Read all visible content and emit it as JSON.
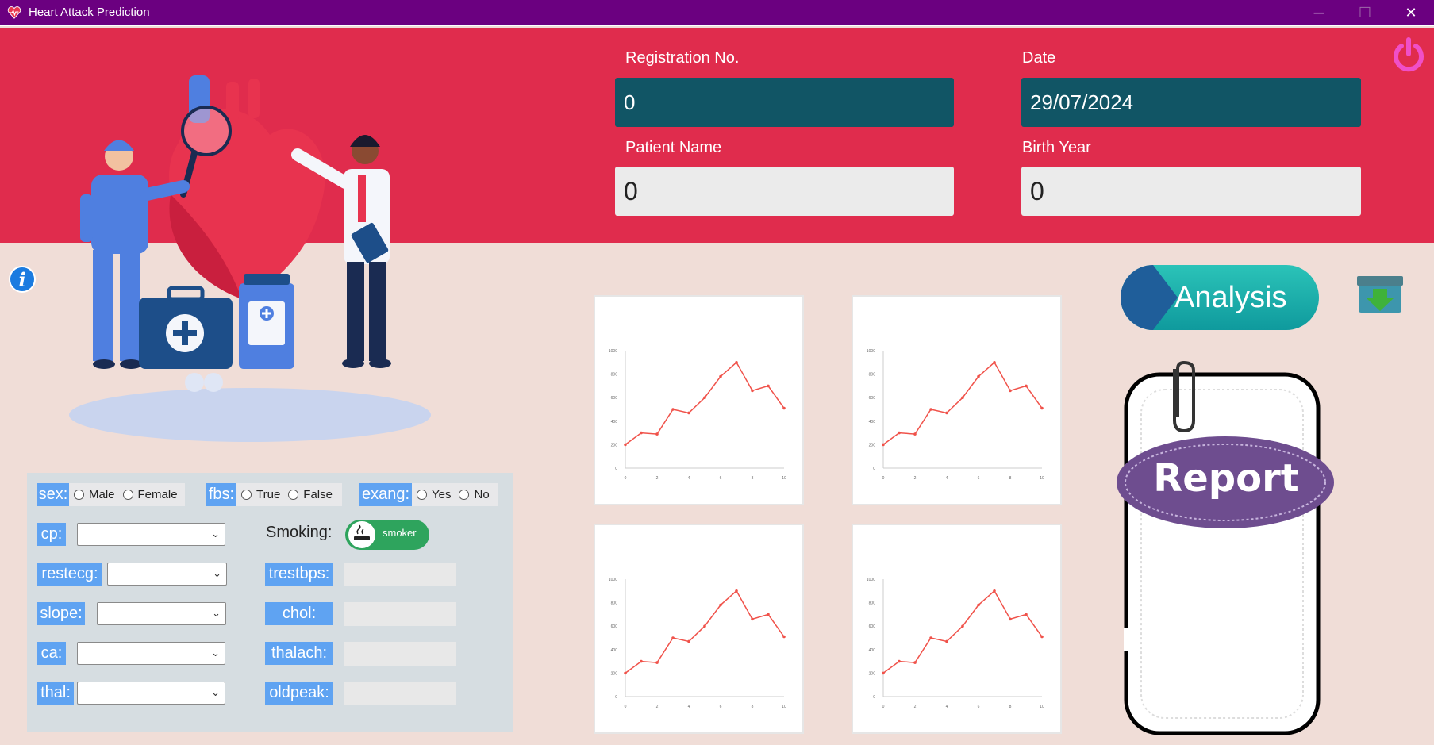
{
  "window": {
    "title": "Heart Attack Prediction",
    "minimize": "─",
    "maximize": "☐",
    "close": "✕"
  },
  "header": {
    "registration_label": "Registration No.",
    "registration_value": "0",
    "date_label": "Date",
    "date_value": "29/07/2024",
    "patient_label": "Patient Name",
    "patient_value": "0",
    "birth_label": "Birth Year",
    "birth_value": "0"
  },
  "form": {
    "sex": {
      "label": "sex:",
      "options": [
        "Male",
        "Female"
      ]
    },
    "fbs": {
      "label": "fbs:",
      "options": [
        "True",
        "False"
      ]
    },
    "exang": {
      "label": "exang:",
      "options": [
        "Yes",
        "No"
      ]
    },
    "cp": {
      "label": "cp:"
    },
    "restecg": {
      "label": "restecg:"
    },
    "slope": {
      "label": "slope:"
    },
    "ca": {
      "label": "ca:"
    },
    "thal": {
      "label": "thal:"
    },
    "smoking": {
      "label": "Smoking:",
      "toggle_text": "smoker"
    },
    "trestbps": {
      "label": "trestbps:"
    },
    "chol": {
      "label": "chol:"
    },
    "thalach": {
      "label": "thalach:"
    },
    "oldpeak": {
      "label": "oldpeak:"
    }
  },
  "buttons": {
    "analysis": "Analysis",
    "report": "Report"
  },
  "chart_data": [
    {
      "type": "line",
      "x": [
        0,
        1,
        2,
        3,
        4,
        5,
        6,
        7,
        8,
        9,
        10
      ],
      "y": [
        200,
        300,
        290,
        500,
        470,
        600,
        780,
        900,
        660,
        700,
        510
      ],
      "xlim": [
        0,
        10
      ],
      "ylim": [
        0,
        1000
      ],
      "xticks": [
        "0",
        "2",
        "4",
        "6",
        "8",
        "10"
      ],
      "yticks": [
        "0",
        "200",
        "400",
        "600",
        "800",
        "1000"
      ]
    },
    {
      "type": "line",
      "x": [
        0,
        1,
        2,
        3,
        4,
        5,
        6,
        7,
        8,
        9,
        10
      ],
      "y": [
        200,
        300,
        290,
        500,
        470,
        600,
        780,
        900,
        660,
        700,
        510
      ],
      "xlim": [
        0,
        10
      ],
      "ylim": [
        0,
        1000
      ],
      "xticks": [
        "0",
        "2",
        "4",
        "6",
        "8",
        "10"
      ],
      "yticks": [
        "0",
        "200",
        "400",
        "600",
        "800",
        "1000"
      ]
    },
    {
      "type": "line",
      "x": [
        0,
        1,
        2,
        3,
        4,
        5,
        6,
        7,
        8,
        9,
        10
      ],
      "y": [
        200,
        300,
        290,
        500,
        470,
        600,
        780,
        900,
        660,
        700,
        510
      ],
      "xlim": [
        0,
        10
      ],
      "ylim": [
        0,
        1000
      ],
      "xticks": [
        "0",
        "2",
        "4",
        "6",
        "8",
        "10"
      ],
      "yticks": [
        "0",
        "200",
        "400",
        "600",
        "800",
        "1000"
      ]
    },
    {
      "type": "line",
      "x": [
        0,
        1,
        2,
        3,
        4,
        5,
        6,
        7,
        8,
        9,
        10
      ],
      "y": [
        200,
        300,
        290,
        500,
        470,
        600,
        780,
        900,
        660,
        700,
        510
      ],
      "xlim": [
        0,
        10
      ],
      "ylim": [
        0,
        1000
      ],
      "xticks": [
        "0",
        "2",
        "4",
        "6",
        "8",
        "10"
      ],
      "yticks": [
        "0",
        "200",
        "400",
        "600",
        "800",
        "1000"
      ]
    }
  ],
  "colors": {
    "titlebar": "#6b0080",
    "header": "#e02c4d",
    "background": "#f0ddd7",
    "accent": "#5fa3f2",
    "line": "#f0524a"
  }
}
